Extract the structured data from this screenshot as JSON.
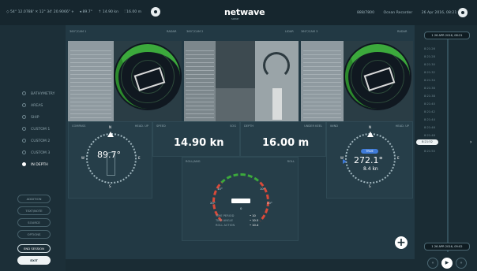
{
  "topbar": {
    "position": "◇ 54° 12.0788' ✕ 12° 34' 20.9066\" ⋄",
    "heading": "◂ 89.7°",
    "speed": "↑ 14.90 kn",
    "depth": "⫶ 16.00 m",
    "app_name": "netwave",
    "app_sub": "sonar",
    "vessel": "888/7800",
    "user": "Ocean Recorder",
    "datetime": "26 Apr 2016, 08:21:32"
  },
  "cameras": [
    {
      "title": "360°/CAM 1",
      "right": "RADAR"
    },
    {
      "title": "360°/CAM 2",
      "right": "LIDAR"
    },
    {
      "title": "360°/CAM 3",
      "right": "RADAR"
    }
  ],
  "layers": [
    {
      "label": "BATHYMETRY",
      "active": false
    },
    {
      "label": "AREAS",
      "active": false
    },
    {
      "label": "SHIP",
      "active": false
    },
    {
      "label": "CUSTOM 1",
      "active": false
    },
    {
      "label": "CUSTOM 2",
      "active": false
    },
    {
      "label": "CUSTOM 3",
      "active": false
    },
    {
      "label": "IN DEPTH",
      "active": true
    }
  ],
  "side_buttons": [
    {
      "label": "ADDITION",
      "style": "normal"
    },
    {
      "label": "TEXT/NOTE",
      "style": "normal"
    },
    {
      "label": "SOURCE",
      "style": "normal"
    },
    {
      "label": "OPTIONS",
      "style": "normal"
    },
    {
      "label": "END SESSION",
      "style": "outline"
    },
    {
      "label": "EXIT",
      "style": "light"
    }
  ],
  "compass": {
    "label": "COMPASS",
    "right": "HEAD. UP",
    "value": "89.7°",
    "north": "N",
    "south": "S",
    "east": "E",
    "west": "W"
  },
  "speed": {
    "label": "SPEED",
    "right": "SOG",
    "value": "14.90 kn"
  },
  "depth": {
    "label": "DEPTH",
    "right": "UNDER KEEL",
    "value": "16.00 m"
  },
  "wind": {
    "label": "WIND",
    "right": "HEAD. UP",
    "badge": "TRUE",
    "value": "272.1°",
    "sub": "8.4 kn",
    "north": "N",
    "south": "S",
    "east": "E",
    "west": "W"
  },
  "roll": {
    "label": "ROLL/ANG",
    "right": "ROLL",
    "left_mark": "20°",
    "right_mark": "20°",
    "left_mark2": "10°",
    "right_mark2": "10°",
    "center_mark": "0",
    "stats": [
      {
        "k": "TIME PERIOD",
        "v": "• 10"
      },
      {
        "k": "TIME ANGLE",
        "v": "• 10.5"
      },
      {
        "k": "ROLL ACTION",
        "v": "• 10.4"
      }
    ]
  },
  "timeline": {
    "start": "1 26 APR 2016, 08:21",
    "end": "1 26 APR 2016, 09:02",
    "ticks": [
      "8:21:26",
      "8:21:28",
      "8:21:30",
      "8:21:32",
      "8:21:34",
      "8:21:36",
      "8:21:38",
      "8:21:40",
      "8:21:42",
      "8:21:44",
      "8:21:46",
      "8:21:48",
      "8:21:50"
    ],
    "cursor": "8:21:52",
    "arrow": "›"
  },
  "player": {
    "prev": "«",
    "play": "▶",
    "next": "»"
  },
  "fab": "+"
}
